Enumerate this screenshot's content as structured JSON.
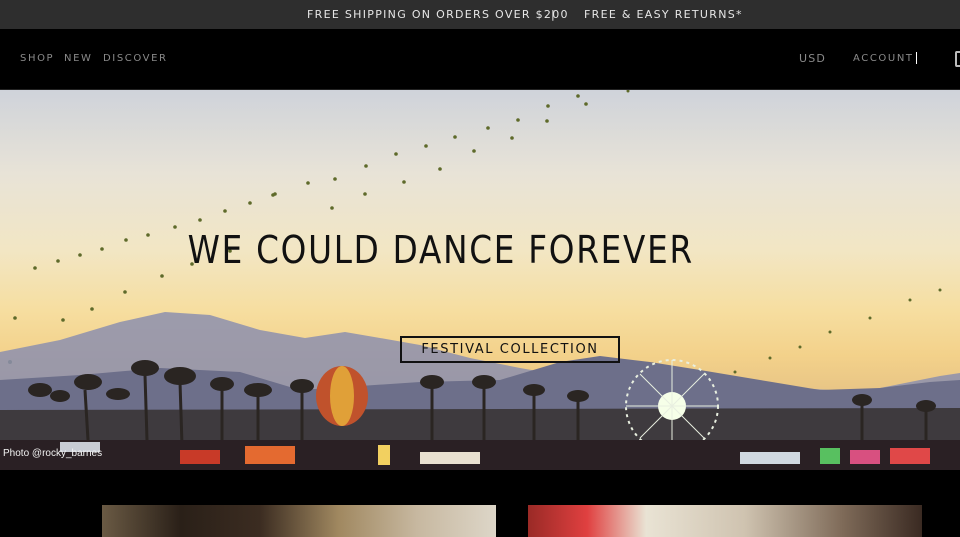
{
  "promo": {
    "shipping_text": "FREE SHIPPING ON ORDERS OVER $200",
    "separator": "|",
    "returns_text": "FREE & EASY RETURNS*"
  },
  "nav": {
    "items": [
      {
        "label": "SHOP"
      },
      {
        "label": "NEW"
      },
      {
        "label": "DISCOVER"
      }
    ],
    "currency": "USD",
    "account": "ACCOUNT"
  },
  "hero": {
    "title": "WE COULD DANCE FOREVER",
    "button_label": "FESTIVAL COLLECTION",
    "photo_credit": "Photo @rocky_barnes"
  },
  "icons": {
    "cart": "cart-icon"
  }
}
